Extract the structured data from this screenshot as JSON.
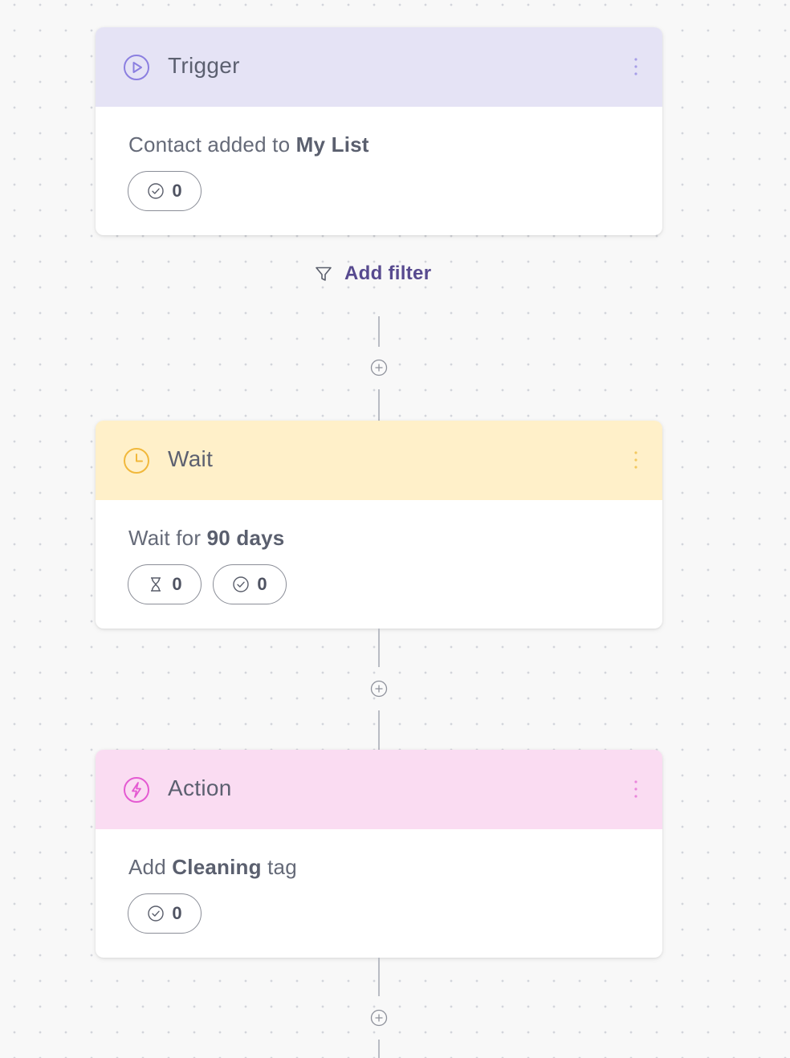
{
  "colors": {
    "trigger_header": "#e5e3f5",
    "trigger_accent": "#8b7fe0",
    "wait_header": "#fff0c9",
    "wait_accent": "#f1b83b",
    "action_header": "#fadcf2",
    "action_accent": "#e45ad2",
    "filter_text": "#574a8f"
  },
  "trigger": {
    "title": "Trigger",
    "icon": "play-circle-icon",
    "text_prefix": "Contact added to ",
    "text_bold": "My List",
    "completed_count": "0"
  },
  "filter": {
    "icon": "filter-icon",
    "label": "Add filter"
  },
  "wait": {
    "title": "Wait",
    "icon": "clock-icon",
    "text_prefix": "Wait for ",
    "text_bold": "90 days",
    "waiting_count": "0",
    "completed_count": "0"
  },
  "action": {
    "title": "Action",
    "icon": "lightning-circle-icon",
    "text_prefix": "Add ",
    "text_bold": "Cleaning",
    "text_suffix": " tag",
    "completed_count": "0"
  }
}
